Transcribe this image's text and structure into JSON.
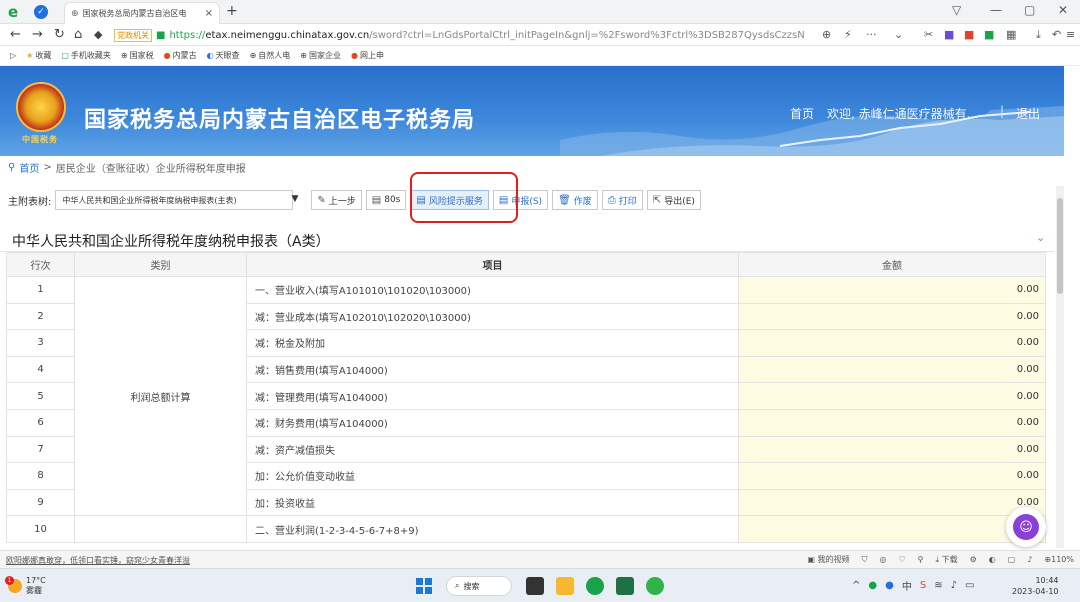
{
  "browser": {
    "tab_title": "国家税务总局内蒙古自治区电",
    "url_tag": "党政机关",
    "url_https": "https://",
    "url_host": "etax.neimenggu.chinatax.gov.cn",
    "url_rest": "/sword?ctrl=LnGdsPortalCtrl_initPageIn&gnlj=%2Fsword%3Fctrl%3DSB287QysdsCzzsN",
    "bookmarks": [
      "收藏",
      "手机收藏夹",
      "国家税",
      "内蒙古",
      "天眼查",
      "自然人电",
      "国家企业",
      "网上申"
    ]
  },
  "banner": {
    "title": "国家税务总局内蒙古自治区电子税务局",
    "emblem_text": "中国税务",
    "home": "首页",
    "welcome": "欢迎, 赤峰仁通医疗器械有...",
    "separator": "|",
    "logout": "退出"
  },
  "breadcrumb": {
    "home": "首页",
    "sep": ">",
    "path": "居民企业（查账征收）企业所得税年度申报"
  },
  "toolbar": {
    "label": "主附表树:",
    "select_value": "中华人民共和国企业所得税年度纳税申报表(主表)",
    "prev": "上一步",
    "timer": "80s",
    "risk": "风险提示服务",
    "submit": "申报(S)",
    "void": "作废",
    "print": "打印",
    "export": "导出(E)"
  },
  "form": {
    "title": "中华人民共和国企业所得税年度纳税申报表（A类）",
    "headers": {
      "row": "行次",
      "category": "类别",
      "item": "项目",
      "amount": "金额"
    },
    "category_label": "利润总额计算",
    "rows": [
      {
        "no": "1",
        "item": "一、营业收入(填写A101010\\101020\\103000)",
        "amount": "0.00"
      },
      {
        "no": "2",
        "item": "减：营业成本(填写A102010\\102020\\103000)",
        "amount": "0.00"
      },
      {
        "no": "3",
        "item": "减：税金及附加",
        "amount": "0.00"
      },
      {
        "no": "4",
        "item": "减：销售费用(填写A104000)",
        "amount": "0.00"
      },
      {
        "no": "5",
        "item": "减：管理费用(填写A104000)",
        "amount": "0.00"
      },
      {
        "no": "6",
        "item": "减：财务费用(填写A104000)",
        "amount": "0.00"
      },
      {
        "no": "7",
        "item": "减：资产减值损失",
        "amount": "0.00"
      },
      {
        "no": "8",
        "item": "加：公允价值变动收益",
        "amount": "0.00"
      },
      {
        "no": "9",
        "item": "加：投资收益",
        "amount": "0.00"
      },
      {
        "no": "10",
        "item": "二、营业利润(1-2-3-4-5-6-7+8+9)",
        "amount": ""
      }
    ]
  },
  "statusbar": {
    "news": "欧阳娜娜真敢穿，低领口看实锤，窈窕少女青春洋溢",
    "video": "我的视频",
    "download": "下载",
    "zoom": "110%"
  },
  "taskbar": {
    "temp": "17°C",
    "weather": "雾霾",
    "weather_badge": "1",
    "search": "搜索",
    "time": "10:44",
    "date": "2023-04-10"
  },
  "colors": {
    "banner": "#2a6fc9",
    "amount_bg": "#fdfbe2",
    "highlight": "#e02020"
  }
}
